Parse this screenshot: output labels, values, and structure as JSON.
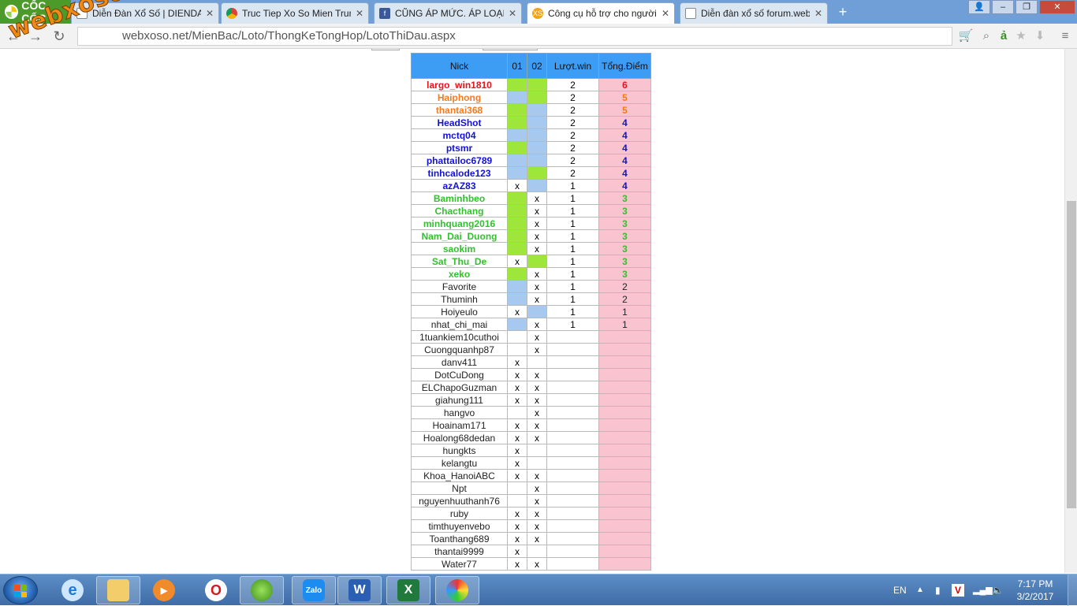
{
  "browser": {
    "brand": "CỐC CỐC",
    "tabs": [
      {
        "label": "Diễn Đàn Xổ Số | DIENDAN",
        "icon": "page-icon",
        "active": false
      },
      {
        "label": "Truc Tiep Xo So Mien Trun",
        "icon": "chrome-icon",
        "active": false
      },
      {
        "label": "CŨNG ÁP MỨC. ÁP LOẠI.B",
        "icon": "facebook-icon",
        "active": false
      },
      {
        "label": "Công cụ hỗ trợ cho người",
        "icon": "xs-icon",
        "active": true
      },
      {
        "label": "Diễn đàn xổ số forum.web",
        "icon": "page-icon",
        "active": false
      }
    ],
    "url": "webxoso.net/MienBac/Loto/ThongKeTongHop/LotoThiDau.aspx"
  },
  "watermark": "webxoso.net",
  "table": {
    "headers": [
      "Nick",
      "01",
      "02",
      "Lượt.win",
      "Tổng.Điểm"
    ],
    "rows": [
      {
        "nick": "largo_win1810",
        "c1": "",
        "c2": "",
        "s1": "g",
        "s2": "g",
        "win": "2",
        "pts": "6",
        "color": "cr"
      },
      {
        "nick": "Haiphong",
        "c1": "",
        "c2": "",
        "s1": "b",
        "s2": "g",
        "win": "2",
        "pts": "5",
        "color": "co"
      },
      {
        "nick": "thantai368",
        "c1": "",
        "c2": "",
        "s1": "g",
        "s2": "b",
        "win": "2",
        "pts": "5",
        "color": "co"
      },
      {
        "nick": "HeadShot",
        "c1": "",
        "c2": "",
        "s1": "g",
        "s2": "b",
        "win": "2",
        "pts": "4",
        "color": "cb"
      },
      {
        "nick": "mctq04",
        "c1": "",
        "c2": "",
        "s1": "b",
        "s2": "b",
        "win": "2",
        "pts": "4",
        "color": "cb"
      },
      {
        "nick": "ptsmr",
        "c1": "",
        "c2": "",
        "s1": "g",
        "s2": "b",
        "win": "2",
        "pts": "4",
        "color": "cb"
      },
      {
        "nick": "phattailoc6789",
        "c1": "",
        "c2": "",
        "s1": "b",
        "s2": "b",
        "win": "2",
        "pts": "4",
        "color": "cb"
      },
      {
        "nick": "tinhcalode123",
        "c1": "",
        "c2": "",
        "s1": "b",
        "s2": "g",
        "win": "2",
        "pts": "4",
        "color": "cb"
      },
      {
        "nick": "azAZ83",
        "c1": "x",
        "c2": "",
        "s1": "",
        "s2": "b",
        "win": "1",
        "pts": "4",
        "color": "cb"
      },
      {
        "nick": "Baminhbeo",
        "c1": "",
        "c2": "x",
        "s1": "g",
        "s2": "",
        "win": "1",
        "pts": "3",
        "color": "cg"
      },
      {
        "nick": "Chacthang",
        "c1": "",
        "c2": "x",
        "s1": "g",
        "s2": "",
        "win": "1",
        "pts": "3",
        "color": "cg"
      },
      {
        "nick": "minhquang2016",
        "c1": "",
        "c2": "x",
        "s1": "g",
        "s2": "",
        "win": "1",
        "pts": "3",
        "color": "cg"
      },
      {
        "nick": "Nam_Dai_Duong",
        "c1": "",
        "c2": "x",
        "s1": "g",
        "s2": "",
        "win": "1",
        "pts": "3",
        "color": "cg"
      },
      {
        "nick": "saokim",
        "c1": "",
        "c2": "x",
        "s1": "g",
        "s2": "",
        "win": "1",
        "pts": "3",
        "color": "cg"
      },
      {
        "nick": "Sat_Thu_De",
        "c1": "x",
        "c2": "",
        "s1": "",
        "s2": "g",
        "win": "1",
        "pts": "3",
        "color": "cg"
      },
      {
        "nick": "xeko",
        "c1": "",
        "c2": "x",
        "s1": "g",
        "s2": "",
        "win": "1",
        "pts": "3",
        "color": "cg"
      },
      {
        "nick": "Favorite",
        "c1": "",
        "c2": "x",
        "s1": "b",
        "s2": "",
        "win": "1",
        "pts": "2",
        "color": "ck"
      },
      {
        "nick": "Thuminh",
        "c1": "",
        "c2": "x",
        "s1": "b",
        "s2": "",
        "win": "1",
        "pts": "2",
        "color": "ck"
      },
      {
        "nick": "Hoiyeulo",
        "c1": "x",
        "c2": "",
        "s1": "",
        "s2": "b",
        "win": "1",
        "pts": "1",
        "color": "ck"
      },
      {
        "nick": "nhat_chi_mai",
        "c1": "",
        "c2": "x",
        "s1": "b",
        "s2": "",
        "win": "1",
        "pts": "1",
        "color": "ck"
      },
      {
        "nick": "1tuankiem10cuthoi",
        "c1": "",
        "c2": "x",
        "s1": "",
        "s2": "",
        "win": "",
        "pts": "",
        "color": "ck"
      },
      {
        "nick": "Cuongquanhp87",
        "c1": "",
        "c2": "x",
        "s1": "",
        "s2": "",
        "win": "",
        "pts": "",
        "color": "ck"
      },
      {
        "nick": "danv411",
        "c1": "x",
        "c2": "",
        "s1": "",
        "s2": "",
        "win": "",
        "pts": "",
        "color": "ck"
      },
      {
        "nick": "DotCuDong",
        "c1": "x",
        "c2": "x",
        "s1": "",
        "s2": "",
        "win": "",
        "pts": "",
        "color": "ck"
      },
      {
        "nick": "ELChapoGuzman",
        "c1": "x",
        "c2": "x",
        "s1": "",
        "s2": "",
        "win": "",
        "pts": "",
        "color": "ck"
      },
      {
        "nick": "giahung111",
        "c1": "x",
        "c2": "x",
        "s1": "",
        "s2": "",
        "win": "",
        "pts": "",
        "color": "ck"
      },
      {
        "nick": "hangvo",
        "c1": "",
        "c2": "x",
        "s1": "",
        "s2": "",
        "win": "",
        "pts": "",
        "color": "ck"
      },
      {
        "nick": "Hoainam171",
        "c1": "x",
        "c2": "x",
        "s1": "",
        "s2": "",
        "win": "",
        "pts": "",
        "color": "ck"
      },
      {
        "nick": "Hoalong68dedan",
        "c1": "x",
        "c2": "x",
        "s1": "",
        "s2": "",
        "win": "",
        "pts": "",
        "color": "ck"
      },
      {
        "nick": "hungkts",
        "c1": "x",
        "c2": "",
        "s1": "",
        "s2": "",
        "win": "",
        "pts": "",
        "color": "ck"
      },
      {
        "nick": "kelangtu",
        "c1": "x",
        "c2": "",
        "s1": "",
        "s2": "",
        "win": "",
        "pts": "",
        "color": "ck"
      },
      {
        "nick": "Khoa_HanoiABC",
        "c1": "x",
        "c2": "x",
        "s1": "",
        "s2": "",
        "win": "",
        "pts": "",
        "color": "ck"
      },
      {
        "nick": "Npt",
        "c1": "",
        "c2": "x",
        "s1": "",
        "s2": "",
        "win": "",
        "pts": "",
        "color": "ck"
      },
      {
        "nick": "nguyenhuuthanh76",
        "c1": "",
        "c2": "x",
        "s1": "",
        "s2": "",
        "win": "",
        "pts": "",
        "color": "ck"
      },
      {
        "nick": "ruby",
        "c1": "x",
        "c2": "x",
        "s1": "",
        "s2": "",
        "win": "",
        "pts": "",
        "color": "ck"
      },
      {
        "nick": "timthuyenvebo",
        "c1": "x",
        "c2": "x",
        "s1": "",
        "s2": "",
        "win": "",
        "pts": "",
        "color": "ck"
      },
      {
        "nick": "Toanthang689",
        "c1": "x",
        "c2": "x",
        "s1": "",
        "s2": "",
        "win": "",
        "pts": "",
        "color": "ck"
      },
      {
        "nick": "thantai9999",
        "c1": "x",
        "c2": "",
        "s1": "",
        "s2": "",
        "win": "",
        "pts": "",
        "color": "ck"
      },
      {
        "nick": "Water77",
        "c1": "x",
        "c2": "x",
        "s1": "",
        "s2": "",
        "win": "",
        "pts": "",
        "color": "ck"
      }
    ]
  },
  "taskbar": {
    "apps": [
      {
        "name": "internet-explorer",
        "label": "e",
        "open": false
      },
      {
        "name": "file-explorer",
        "label": "",
        "open": true
      },
      {
        "name": "media-player",
        "label": "▶",
        "open": false
      },
      {
        "name": "opera",
        "label": "O",
        "open": false
      },
      {
        "name": "coccoc",
        "label": "",
        "open": true
      },
      {
        "name": "zalo",
        "label": "Zalo",
        "open": true
      },
      {
        "name": "word",
        "label": "W",
        "open": true
      },
      {
        "name": "excel",
        "label": "X",
        "open": true
      },
      {
        "name": "paint",
        "label": "",
        "open": true
      }
    ],
    "language": "EN",
    "time": "7:17 PM",
    "date": "3/2/2017"
  }
}
